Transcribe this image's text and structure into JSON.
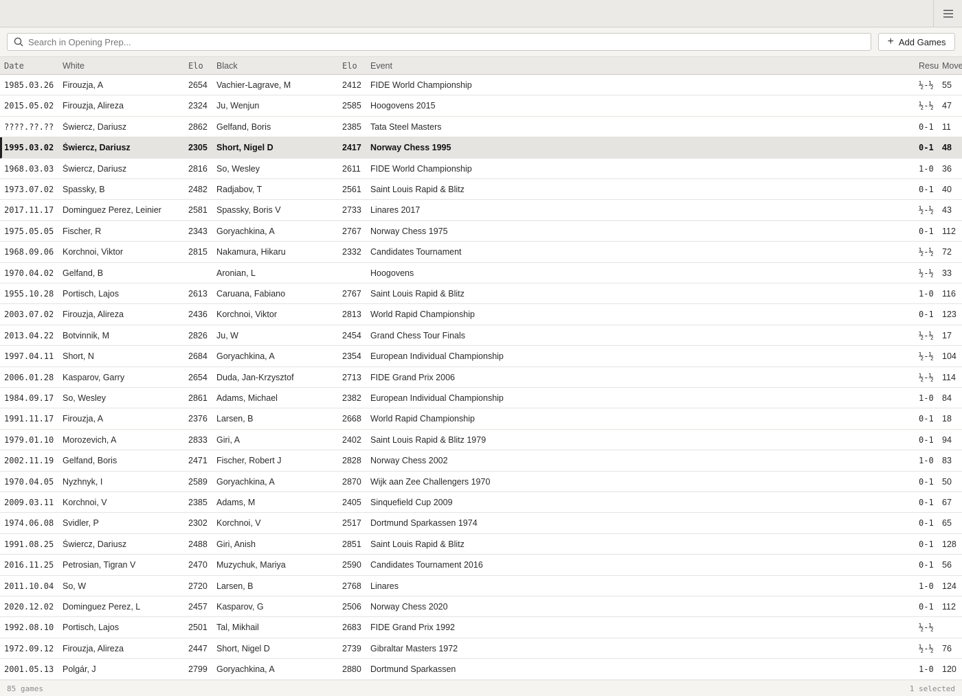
{
  "toolbar": {
    "menu_icon": "hamburger-menu-icon",
    "search_placeholder": "Search in Opening Prep...",
    "search_value": "",
    "add_games_label": "Add Games"
  },
  "columns": [
    "Date",
    "White",
    "Elo",
    "Black",
    "Elo",
    "Event",
    "Resu",
    "Move"
  ],
  "rows": [
    {
      "date": "1985.03.26",
      "white": "Firouzja, A",
      "welo": "2654",
      "black": "Vachier-Lagrave, M",
      "belo": "2412",
      "event": "FIDE World Championship",
      "result": "½-½",
      "moves": "55"
    },
    {
      "date": "2015.05.02",
      "white": "Firouzja, Alireza",
      "welo": "2324",
      "black": "Ju, Wenjun",
      "belo": "2585",
      "event": "Hoogovens 2015",
      "result": "½-½",
      "moves": "47"
    },
    {
      "date": "????.??.??",
      "white": "Świercz, Dariusz",
      "welo": "2862",
      "black": "Gelfand, Boris",
      "belo": "2385",
      "event": "Tata Steel Masters",
      "result": "0-1",
      "moves": "11"
    },
    {
      "date": "1995.03.02",
      "white": "Świercz, Dariusz",
      "welo": "2305",
      "black": "Short, Nigel D",
      "belo": "2417",
      "event": "Norway Chess 1995",
      "result": "0-1",
      "moves": "48",
      "selected": true
    },
    {
      "date": "1968.03.03",
      "white": "Świercz, Dariusz",
      "welo": "2816",
      "black": "So, Wesley",
      "belo": "2611",
      "event": "FIDE World Championship",
      "result": "1-0",
      "moves": "36"
    },
    {
      "date": "1973.07.02",
      "white": "Spassky, B",
      "welo": "2482",
      "black": "Radjabov, T",
      "belo": "2561",
      "event": "Saint Louis Rapid & Blitz",
      "result": "0-1",
      "moves": "40"
    },
    {
      "date": "2017.11.17",
      "white": "Dominguez Perez, Leinier",
      "welo": "2581",
      "black": "Spassky, Boris V",
      "belo": "2733",
      "event": "Linares 2017",
      "result": "½-½",
      "moves": "43"
    },
    {
      "date": "1975.05.05",
      "white": "Fischer, R",
      "welo": "2343",
      "black": "Goryachkina, A",
      "belo": "2767",
      "event": "Norway Chess 1975",
      "result": "0-1",
      "moves": "112"
    },
    {
      "date": "1968.09.06",
      "white": "Korchnoi, Viktor",
      "welo": "2815",
      "black": "Nakamura, Hikaru",
      "belo": "2332",
      "event": "Candidates Tournament",
      "result": "½-½",
      "moves": "72"
    },
    {
      "date": "1970.04.02",
      "white": "Gelfand, B",
      "welo": "",
      "black": "Aronian, L",
      "belo": "",
      "event": "Hoogovens",
      "result": "½-½",
      "moves": "33"
    },
    {
      "date": "1955.10.28",
      "white": "Portisch, Lajos",
      "welo": "2613",
      "black": "Caruana, Fabiano",
      "belo": "2767",
      "event": "Saint Louis Rapid & Blitz",
      "result": "1-0",
      "moves": "116"
    },
    {
      "date": "2003.07.02",
      "white": "Firouzja, Alireza",
      "welo": "2436",
      "black": "Korchnoi, Viktor",
      "belo": "2813",
      "event": "World Rapid Championship",
      "result": "0-1",
      "moves": "123"
    },
    {
      "date": "2013.04.22",
      "white": "Botvinnik, M",
      "welo": "2826",
      "black": "Ju, W",
      "belo": "2454",
      "event": "Grand Chess Tour Finals",
      "result": "½-½",
      "moves": "17"
    },
    {
      "date": "1997.04.11",
      "white": "Short, N",
      "welo": "2684",
      "black": "Goryachkina, A",
      "belo": "2354",
      "event": "European Individual Championship",
      "result": "½-½",
      "moves": "104"
    },
    {
      "date": "2006.01.28",
      "white": "Kasparov, Garry",
      "welo": "2654",
      "black": "Duda, Jan-Krzysztof",
      "belo": "2713",
      "event": "FIDE Grand Prix 2006",
      "result": "½-½",
      "moves": "114"
    },
    {
      "date": "1984.09.17",
      "white": "So, Wesley",
      "welo": "2861",
      "black": "Adams, Michael",
      "belo": "2382",
      "event": "European Individual Championship",
      "result": "1-0",
      "moves": "84"
    },
    {
      "date": "1991.11.17",
      "white": "Firouzja, A",
      "welo": "2376",
      "black": "Larsen, B",
      "belo": "2668",
      "event": "World Rapid Championship",
      "result": "0-1",
      "moves": "18"
    },
    {
      "date": "1979.01.10",
      "white": "Morozevich, A",
      "welo": "2833",
      "black": "Giri, A",
      "belo": "2402",
      "event": "Saint Louis Rapid & Blitz 1979",
      "result": "0-1",
      "moves": "94"
    },
    {
      "date": "2002.11.19",
      "white": "Gelfand, Boris",
      "welo": "2471",
      "black": "Fischer, Robert J",
      "belo": "2828",
      "event": "Norway Chess 2002",
      "result": "1-0",
      "moves": "83"
    },
    {
      "date": "1970.04.05",
      "white": "Nyzhnyk, I",
      "welo": "2589",
      "black": "Goryachkina, A",
      "belo": "2870",
      "event": "Wijk aan Zee Challengers 1970",
      "result": "0-1",
      "moves": "50"
    },
    {
      "date": "2009.03.11",
      "white": "Korchnoi, V",
      "welo": "2385",
      "black": "Adams, M",
      "belo": "2405",
      "event": "Sinquefield Cup 2009",
      "result": "0-1",
      "moves": "67"
    },
    {
      "date": "1974.06.08",
      "white": "Svidler, P",
      "welo": "2302",
      "black": "Korchnoi, V",
      "belo": "2517",
      "event": "Dortmund Sparkassen 1974",
      "result": "0-1",
      "moves": "65"
    },
    {
      "date": "1991.08.25",
      "white": "Świercz, Dariusz",
      "welo": "2488",
      "black": "Giri, Anish",
      "belo": "2851",
      "event": "Saint Louis Rapid & Blitz",
      "result": "0-1",
      "moves": "128"
    },
    {
      "date": "2016.11.25",
      "white": "Petrosian, Tigran V",
      "welo": "2470",
      "black": "Muzychuk, Mariya",
      "belo": "2590",
      "event": "Candidates Tournament 2016",
      "result": "0-1",
      "moves": "56"
    },
    {
      "date": "2011.10.04",
      "white": "So, W",
      "welo": "2720",
      "black": "Larsen, B",
      "belo": "2768",
      "event": "Linares",
      "result": "1-0",
      "moves": "124"
    },
    {
      "date": "2020.12.02",
      "white": "Dominguez Perez, L",
      "welo": "2457",
      "black": "Kasparov, G",
      "belo": "2506",
      "event": "Norway Chess 2020",
      "result": "0-1",
      "moves": "112"
    },
    {
      "date": "1992.08.10",
      "white": "Portisch, Lajos",
      "welo": "2501",
      "black": "Tal, Mikhail",
      "belo": "2683",
      "event": "FIDE Grand Prix 1992",
      "result": "½-½",
      "moves": ""
    },
    {
      "date": "1972.09.12",
      "white": "Firouzja, Alireza",
      "welo": "2447",
      "black": "Short, Nigel D",
      "belo": "2739",
      "event": "Gibraltar Masters 1972",
      "result": "½-½",
      "moves": "76"
    },
    {
      "date": "2001.05.13",
      "white": "Polgár, J",
      "welo": "2799",
      "black": "Goryachkina, A",
      "belo": "2880",
      "event": "Dortmund Sparkassen",
      "result": "1-0",
      "moves": "120"
    }
  ],
  "status": {
    "count_label": "85 games",
    "selected_label": "1 selected"
  }
}
